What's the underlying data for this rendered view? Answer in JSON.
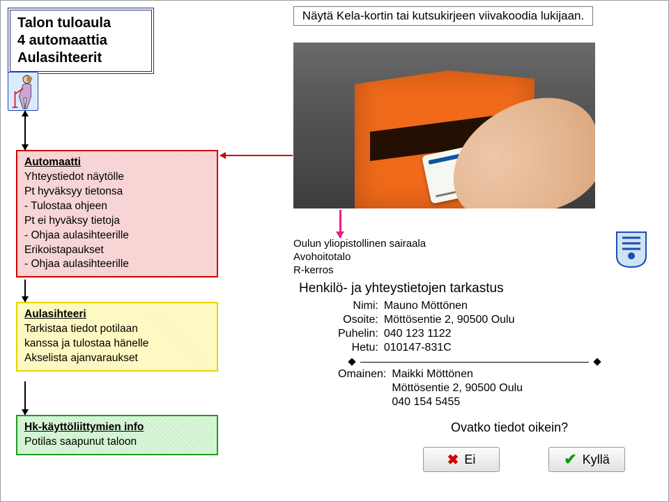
{
  "title_box": {
    "line1": "Talon tuloaula",
    "line2": "4 automaattia",
    "line3": "Aulasihteerit"
  },
  "instruction": "Näytä Kela-kortin tai kutsukirjeen viivakoodia lukijaan.",
  "red": {
    "heading": "Automaatti",
    "lines": [
      "Yhteystiedot näytölle",
      "Pt hyväksyy tietonsa",
      "- Tulostaa ohjeen",
      "Pt ei hyväksy tietoja",
      "- Ohjaa aulasihteerille",
      "Erikoistapaukset",
      "- Ohjaa aulasihteerille"
    ]
  },
  "yellow": {
    "heading": "Aulasihteeri",
    "lines": [
      "Tarkistaa tiedot potilaan",
      "kanssa ja tulostaa hänelle",
      "Akselista ajanvaraukset"
    ]
  },
  "green": {
    "heading": "Hk-käyttöliittymien info",
    "lines": [
      "Potilas saapunut taloon"
    ]
  },
  "info": {
    "hospital": "Oulun yliopistollinen sairaala",
    "dept": "Avohoitotalo",
    "floor": "R-kerros",
    "check_title": "Henkilö- ja yhteystietojen tarkastus",
    "labels": {
      "name": "Nimi:",
      "address": "Osoite:",
      "phone": "Puhelin:",
      "ssn": "Hetu:",
      "relative": "Omainen:"
    },
    "name": "Mauno Möttönen",
    "address": "Möttösentie 2, 90500 Oulu",
    "phone": "040 123 1122",
    "ssn": "010147-831C",
    "relative_name": "Maikki Möttönen",
    "relative_address": "Möttösentie 2, 90500 Oulu",
    "relative_phone": "040 154 5455"
  },
  "question": "Ovatko tiedot oikein?",
  "buttons": {
    "no": "Ei",
    "yes": "Kyllä"
  }
}
